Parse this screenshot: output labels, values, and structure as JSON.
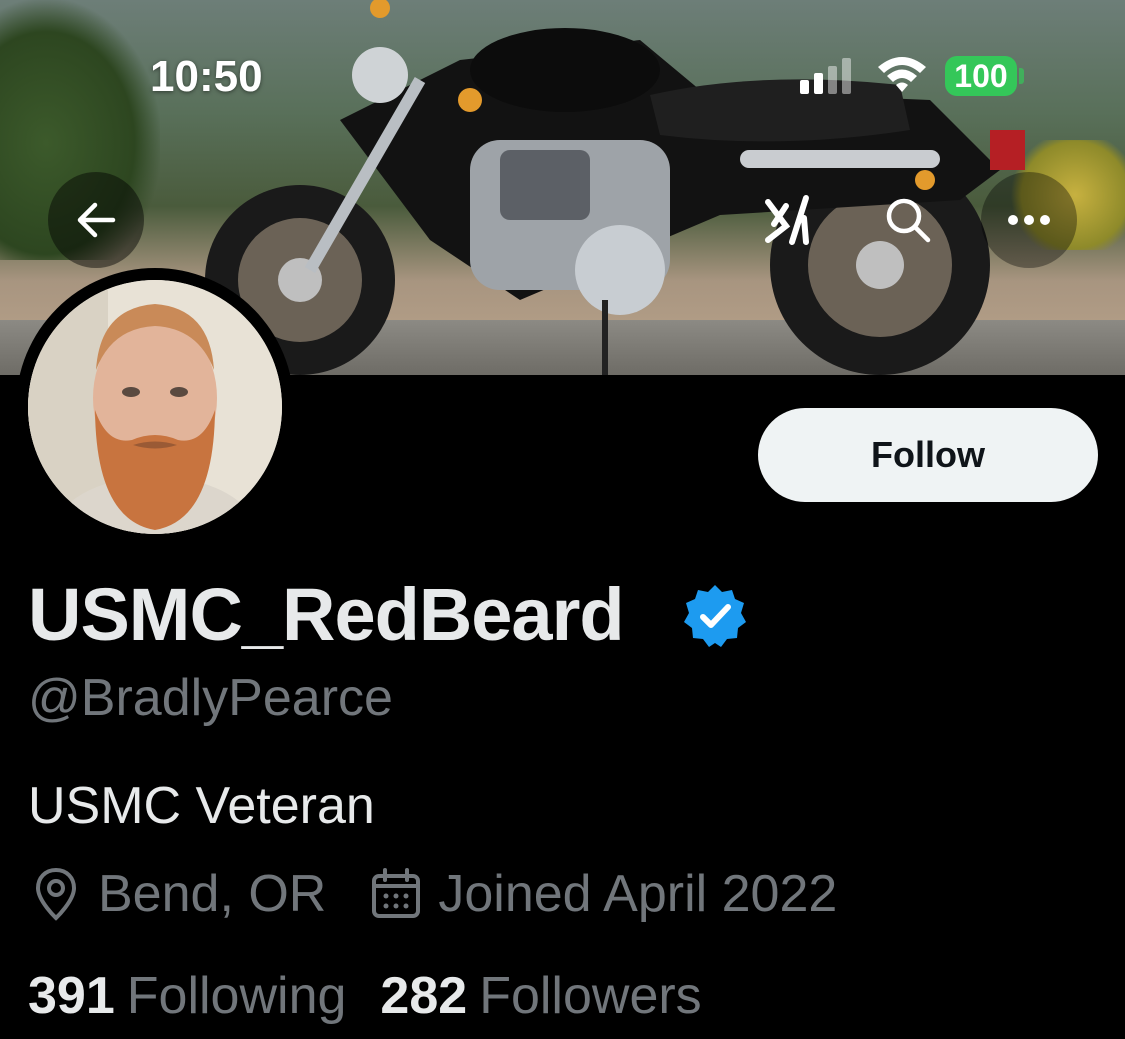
{
  "status_bar": {
    "time": "10:50",
    "battery": "100",
    "battery_color": "#34c759"
  },
  "nav": {
    "back_icon": "arrow-left-icon",
    "grok_icon": "grok-icon",
    "search_icon": "search-icon",
    "more_icon": "more-horizontal-icon"
  },
  "profile": {
    "display_name": "USMC_RedBeard",
    "verified_badge_color": "#1d9bf0",
    "handle": "@BradlyPearce",
    "bio": "USMC Veteran",
    "location": "Bend, OR",
    "joined": "Joined April 2022",
    "following_count": "391",
    "following_label": "Following",
    "followers_count": "282",
    "followers_label": "Followers"
  },
  "actions": {
    "follow_label": "Follow"
  },
  "colors": {
    "background": "#000000",
    "primary_text": "#e7e9ea",
    "secondary_text": "#71767b",
    "button_bg": "#eff3f4"
  }
}
